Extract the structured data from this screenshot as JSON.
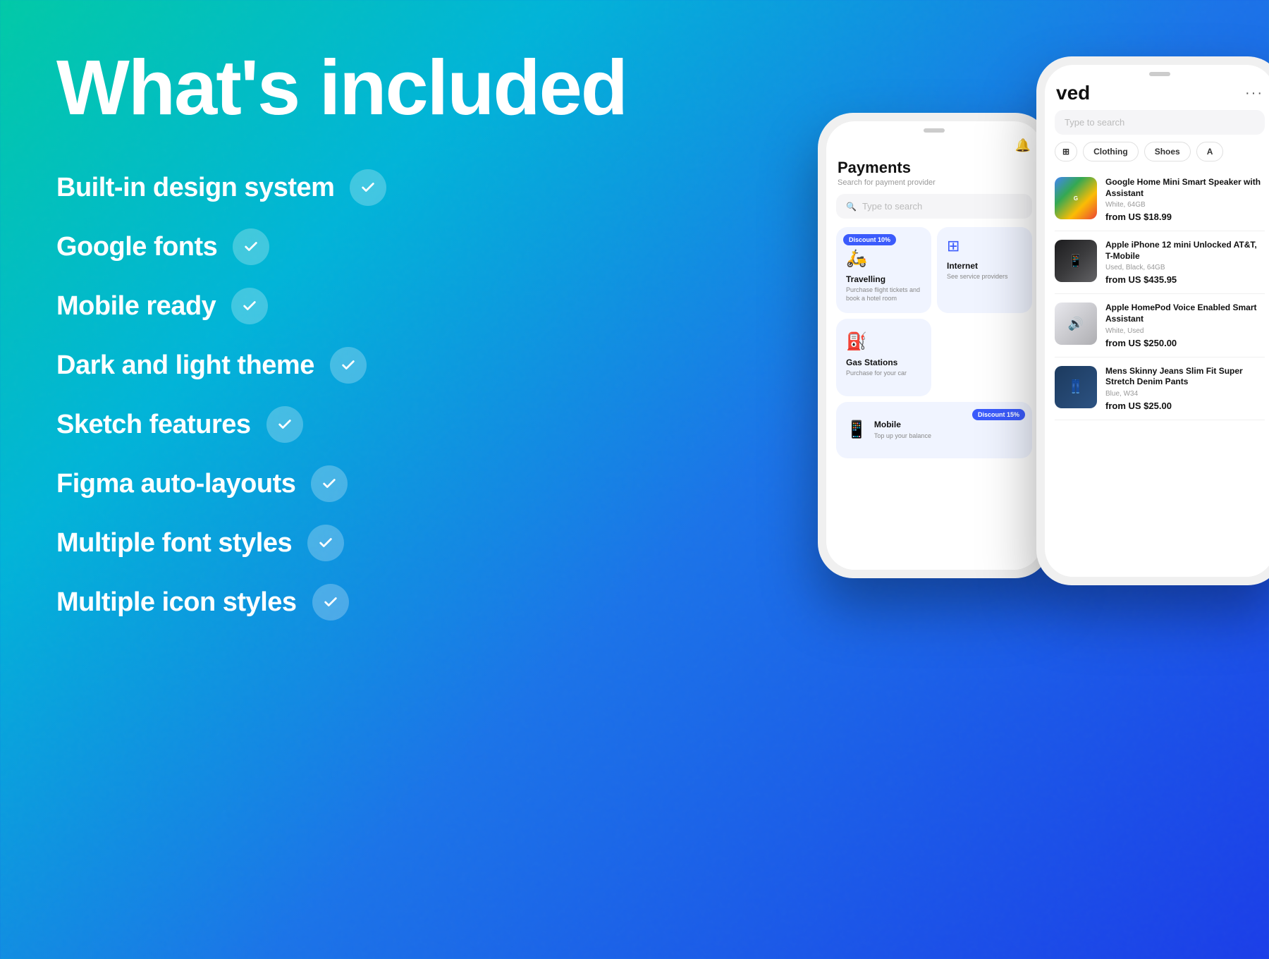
{
  "page": {
    "title": "What's included",
    "background_gradient": "teal-to-blue"
  },
  "features": [
    {
      "id": "design-system",
      "label": "Built-in design system",
      "has_check": true
    },
    {
      "id": "google-fonts",
      "label": "Google fonts",
      "has_check": true
    },
    {
      "id": "mobile-ready",
      "label": "Mobile ready",
      "has_check": true
    },
    {
      "id": "dark-light",
      "label": "Dark and light theme",
      "has_check": true
    },
    {
      "id": "sketch",
      "label": "Sketch features",
      "has_check": true
    },
    {
      "id": "figma-layouts",
      "label": "Figma auto-layouts",
      "has_check": true
    },
    {
      "id": "font-styles",
      "label": "Multiple font styles",
      "has_check": true
    },
    {
      "id": "icon-styles",
      "label": "Multiple icon styles",
      "has_check": true
    }
  ],
  "phone_left": {
    "screen": "Payments",
    "title": "Payments",
    "subtitle": "Search for payment provider",
    "search_placeholder": "Type to search",
    "cards": [
      {
        "id": "travelling",
        "badge": "Discount 10%",
        "icon": "🛵",
        "title": "Travelling",
        "desc": "Purchase flight tickets and book a hotel room"
      },
      {
        "id": "internet",
        "icon": "⊞",
        "title": "Internet",
        "desc": "See service providers"
      },
      {
        "id": "gas-stations",
        "icon": "⛽",
        "title": "Gas Stations",
        "desc": "Purchase for your car"
      }
    ],
    "mobile_card": {
      "badge": "Discount 15%",
      "icon": "📱",
      "title": "Mobile",
      "desc": "Top up your balance"
    }
  },
  "phone_right": {
    "screen": "Saved",
    "title": "ved",
    "search_placeholder": "Type to search",
    "categories": [
      "Categories",
      "Clothing",
      "Shoes",
      "A"
    ],
    "products": [
      {
        "id": "google-home",
        "name": "Google Home Mini Smart Speaker with Assistant",
        "variant": "White, 64GB",
        "price": "from US $18.99",
        "img_type": "google"
      },
      {
        "id": "iphone-12",
        "name": "Apple iPhone 12 mini Unlocked AT&T, T-Mobile",
        "variant": "Used, Black, 64GB",
        "price": "from US $435.95",
        "img_type": "iphone"
      },
      {
        "id": "homepod",
        "name": "Apple HomePod Voice Enabled Smart Assistant",
        "variant": "White, Used",
        "price": "from US $250.00",
        "img_type": "homepod"
      },
      {
        "id": "jeans",
        "name": "Mens Skinny Jeans Slim Fit Super Stretch Denim Pants",
        "variant": "Blue, W34",
        "price": "from US $25.00",
        "img_type": "jeans"
      }
    ]
  }
}
